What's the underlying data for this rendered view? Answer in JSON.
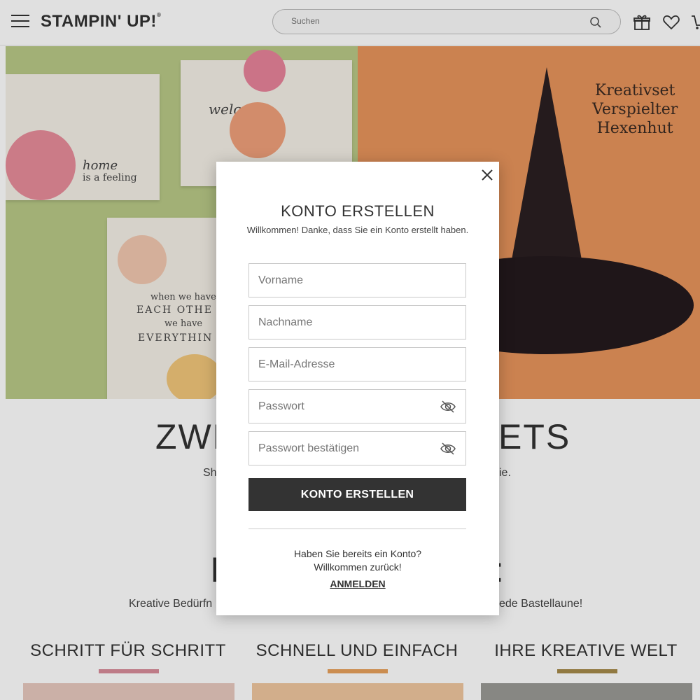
{
  "header": {
    "logo": "STAMPIN' UP!",
    "logo_mark": "®",
    "search_placeholder": "Suchen"
  },
  "hero": {
    "right_caption_line1": "Kreativset",
    "right_caption_line2": "Verspielter",
    "right_caption_line3": "Hexenhut",
    "card_welcome": "welcome",
    "card_home": "home",
    "card_feeling": "is a feeling",
    "card_quote_1": "when we have",
    "card_quote_2": "EACH OTHE",
    "card_quote_3": "we have",
    "card_quote_4": "EVERYTHIN"
  },
  "background": {
    "heading_left": "ZWE",
    "heading_right": "ETS",
    "sub_left": "Sh",
    "sub_right": "ie.",
    "heading2_left": "I",
    "heading2_right": ":",
    "line_left": "Kreative Bedürfn",
    "line_right": "ede Bastellaune!",
    "columns": [
      {
        "title": "SCHRITT FÜR SCHRITT",
        "bar_color": "#d98c9a"
      },
      {
        "title": "SCHNELL UND EINFACH",
        "bar_color": "#e8a15c"
      },
      {
        "title": "IHRE KREATIVE WELT",
        "bar_color": "#a68a4a"
      }
    ]
  },
  "modal": {
    "title": "KONTO ERSTELLEN",
    "subtitle": "Willkommen! Danke, dass Sie ein Konto erstellt haben.",
    "fields": {
      "vorname": "Vorname",
      "nachname": "Nachname",
      "email": "E-Mail-Adresse",
      "passwort": "Passwort",
      "passwort_bestaetigen": "Passwort bestätigen"
    },
    "submit_label": "KONTO ERSTELLEN",
    "have_account_line1": "Haben Sie bereits ein Konto?",
    "have_account_line2": "Willkommen zurück!",
    "login_link": "ANMELDEN"
  },
  "colors": {
    "primary_button": "#333333",
    "hero_green": "#b9c987",
    "hero_orange": "#e8955c"
  }
}
